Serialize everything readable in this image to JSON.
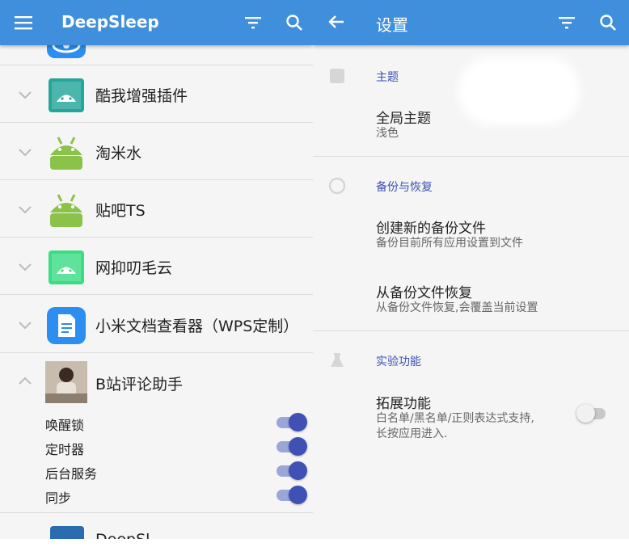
{
  "left": {
    "title": "DeepSleep",
    "apps": [
      {
        "name": "酷我增强插件"
      },
      {
        "name": "淘米水"
      },
      {
        "name": "贴吧TS"
      },
      {
        "name": "网抑叨毛云"
      },
      {
        "name": "小米文档查看器（WPS定制）"
      }
    ],
    "expanded_app": {
      "name": "B站评论助手",
      "options": [
        {
          "label": "唤醒锁",
          "enabled": true
        },
        {
          "label": "定时器",
          "enabled": true
        },
        {
          "label": "后台服务",
          "enabled": true
        },
        {
          "label": "同步",
          "enabled": true
        }
      ]
    },
    "partial_next_app": "DeepSl"
  },
  "right": {
    "title": "设置",
    "sections": {
      "theme": "主题",
      "backup": "备份与恢复",
      "experimental": "实验功能"
    },
    "global_theme": {
      "title": "全局主题",
      "value": "浅色"
    },
    "create_backup": {
      "title": "创建新的备份文件",
      "subtitle": "备份目前所有应用设置到文件"
    },
    "restore_backup": {
      "title": "从备份文件恢复",
      "subtitle": "从备份文件恢复,会覆盖当前设置"
    },
    "extension": {
      "title": "拓展功能",
      "subtitle_line1": "白名单/黑名单/正则表达式支持,",
      "subtitle_line2": "长按应用进入.",
      "enabled": false
    }
  },
  "colors": {
    "appbar": "#3f8fdc",
    "accent": "#3f51b5",
    "android_green": "#8bc34a",
    "wps_blue": "#2b8ef0"
  },
  "icons": [
    "menu-icon",
    "filter-icon",
    "search-icon",
    "back-arrow-icon",
    "chevron-down-icon",
    "chevron-up-icon",
    "android-icon",
    "document-icon"
  ]
}
